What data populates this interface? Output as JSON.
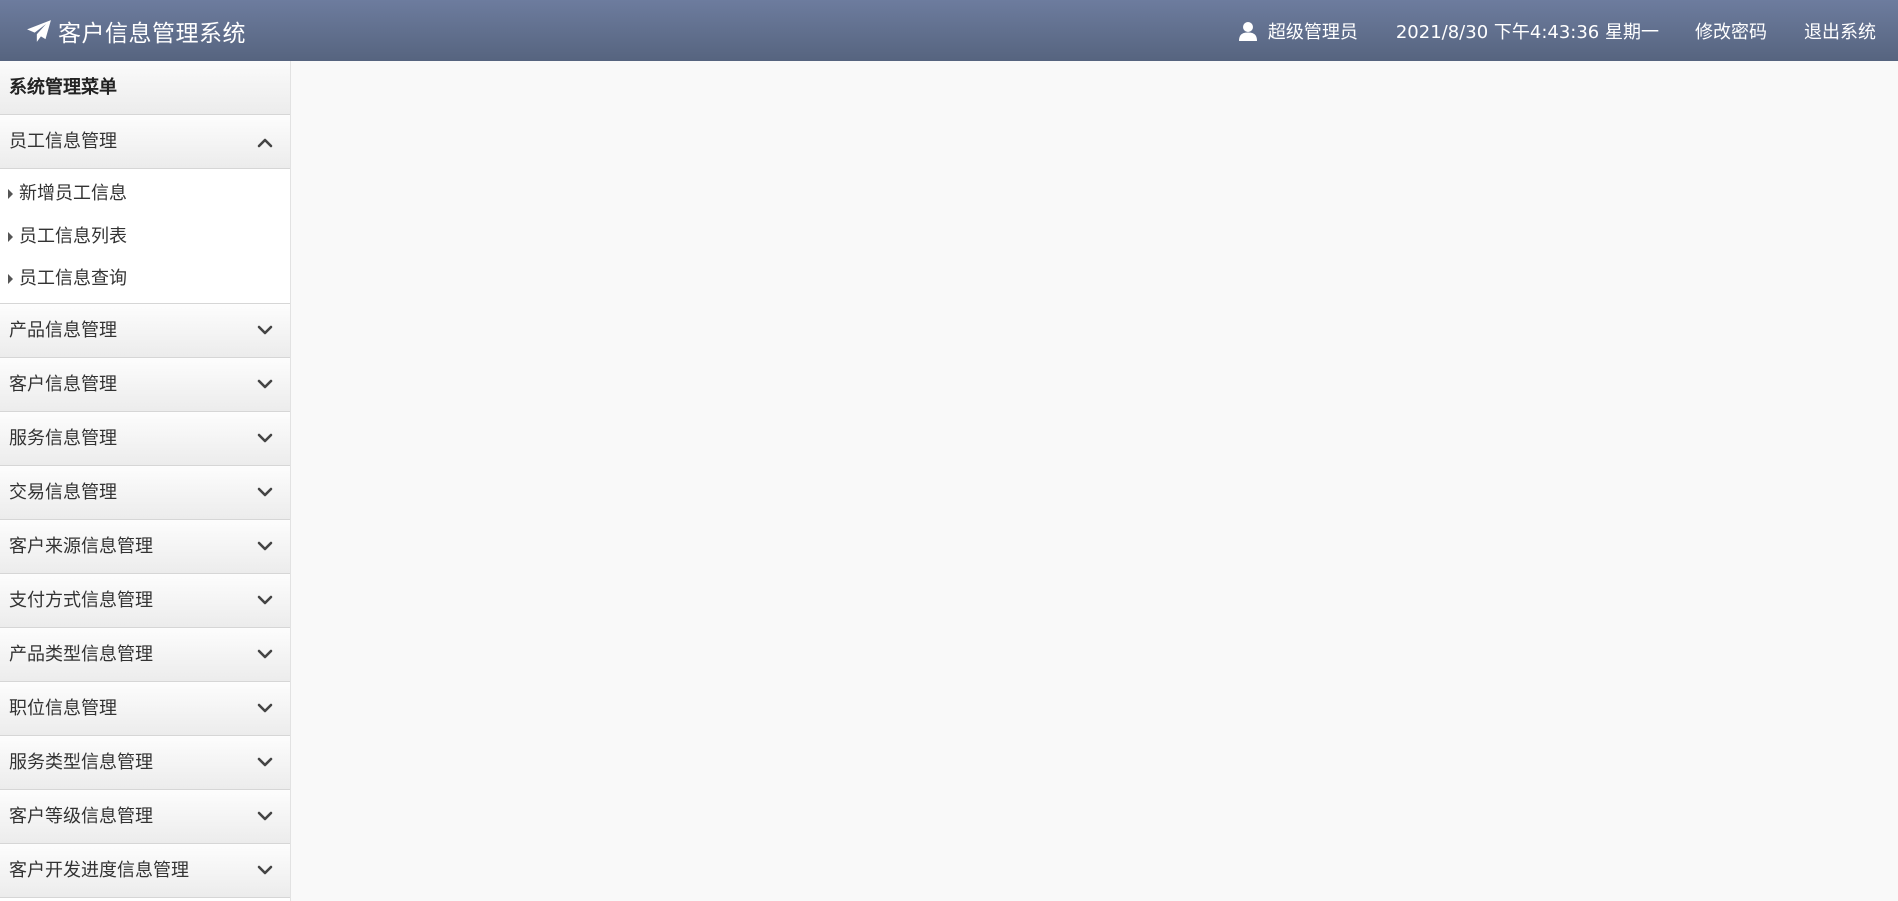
{
  "header": {
    "title": "客户信息管理系统",
    "brand_icon": "paper-plane-icon",
    "user_icon": "user-icon",
    "user_name": "超级管理员",
    "datetime": "2021/8/30 下午4:43:36 星期一",
    "change_password": "修改密码",
    "logout": "退出系统"
  },
  "sidebar": {
    "title": "系统管理菜单",
    "groups": [
      {
        "label": "员工信息管理",
        "expanded": true,
        "items": [
          "新增员工信息",
          "员工信息列表",
          "员工信息查询"
        ]
      },
      {
        "label": "产品信息管理",
        "expanded": false
      },
      {
        "label": "客户信息管理",
        "expanded": false
      },
      {
        "label": "服务信息管理",
        "expanded": false
      },
      {
        "label": "交易信息管理",
        "expanded": false
      },
      {
        "label": "客户来源信息管理",
        "expanded": false
      },
      {
        "label": "支付方式信息管理",
        "expanded": false
      },
      {
        "label": "产品类型信息管理",
        "expanded": false
      },
      {
        "label": "职位信息管理",
        "expanded": false
      },
      {
        "label": "服务类型信息管理",
        "expanded": false
      },
      {
        "label": "客户等级信息管理",
        "expanded": false
      },
      {
        "label": "客户开发进度信息管理",
        "expanded": false
      }
    ]
  },
  "colors": {
    "header_top": "#6d7c9e",
    "header_bottom": "#56647f",
    "page_background": "#f9f9f9"
  }
}
